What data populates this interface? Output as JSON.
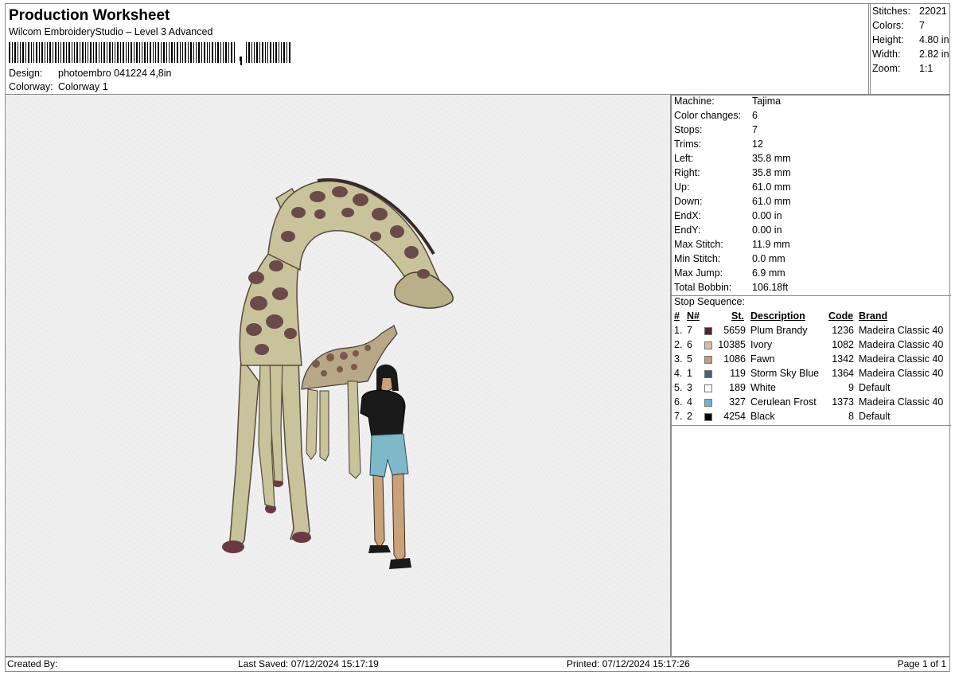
{
  "header": {
    "title": "Production Worksheet",
    "subtitle": "Wilcom EmbroideryStudio – Level 3 Advanced",
    "design_label": "Design:",
    "design_value": "photoembro 041224 4,8in",
    "colorway_label": "Colorway:",
    "colorway_value": "Colorway 1"
  },
  "stats": [
    {
      "label": "Stitches:",
      "value": "22021"
    },
    {
      "label": "Colors:",
      "value": "7"
    },
    {
      "label": "Height:",
      "value": "4.80 in"
    },
    {
      "label": "Width:",
      "value": "2.82 in"
    },
    {
      "label": "Zoom:",
      "value": "1:1"
    }
  ],
  "machine_info": [
    {
      "label": "Machine:",
      "value": "Tajima"
    },
    {
      "label": "Color changes:",
      "value": "6"
    },
    {
      "label": "Stops:",
      "value": "7"
    },
    {
      "label": "Trims:",
      "value": "12"
    },
    {
      "label": "Left:",
      "value": "35.8 mm"
    },
    {
      "label": "Right:",
      "value": "35.8 mm"
    },
    {
      "label": "Up:",
      "value": "61.0 mm"
    },
    {
      "label": "Down:",
      "value": "61.0 mm"
    },
    {
      "label": "EndX:",
      "value": "0.00 in"
    },
    {
      "label": "EndY:",
      "value": "0.00 in"
    },
    {
      "label": "Max Stitch:",
      "value": "11.9 mm"
    },
    {
      "label": "Min Stitch:",
      "value": "0.0 mm"
    },
    {
      "label": "Max Jump:",
      "value": "6.9 mm"
    },
    {
      "label": "Total Bobbin:",
      "value": "106.18ft"
    }
  ],
  "stop_sequence": {
    "title": "Stop Sequence:",
    "columns": {
      "num": "#",
      "n": "N#",
      "st": "St.",
      "description": "Description",
      "code": "Code",
      "brand": "Brand"
    },
    "rows": [
      {
        "num": "1.",
        "n": "7",
        "color": "#4a2530",
        "st": "5659",
        "description": "Plum Brandy",
        "code": "1236",
        "brand": "Madeira Classic 40"
      },
      {
        "num": "2.",
        "n": "6",
        "color": "#d4c0a4",
        "st": "10385",
        "description": "Ivory",
        "code": "1082",
        "brand": "Madeira Classic 40"
      },
      {
        "num": "3.",
        "n": "5",
        "color": "#c49a80",
        "st": "1086",
        "description": "Fawn",
        "code": "1342",
        "brand": "Madeira Classic 40"
      },
      {
        "num": "4.",
        "n": "1",
        "color": "#4e5f7a",
        "st": "119",
        "description": "Storm Sky Blue",
        "code": "1364",
        "brand": "Madeira Classic 40"
      },
      {
        "num": "5.",
        "n": "3",
        "color": "#ffffff",
        "st": "189",
        "description": "White",
        "code": "9",
        "brand": "Default"
      },
      {
        "num": "6.",
        "n": "4",
        "color": "#6fb0d4",
        "st": "327",
        "description": "Cerulean Frost",
        "code": "1373",
        "brand": "Madeira Classic 40"
      },
      {
        "num": "7.",
        "n": "2",
        "color": "#000000",
        "st": "4254",
        "description": "Black",
        "code": "8",
        "brand": "Default"
      }
    ]
  },
  "footer": {
    "created_by": "Created By:",
    "last_saved": "Last Saved: 07/12/2024 15:17:19",
    "printed": "Printed: 07/12/2024 15:17:26",
    "page": "Page 1 of 1"
  }
}
